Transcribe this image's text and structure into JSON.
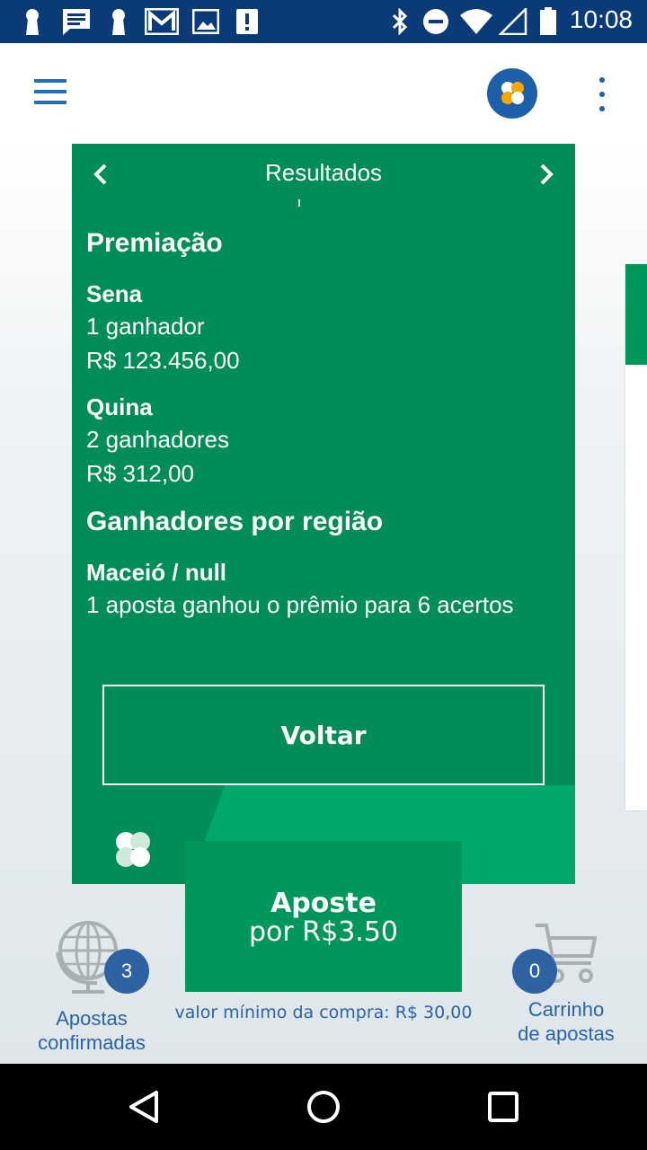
{
  "status_bar": {
    "time": "10:08",
    "icons": [
      "keyhole-icon",
      "message-icon",
      "keyhole-icon",
      "gmail-icon",
      "image-icon",
      "alert-icon",
      "bluetooth-icon",
      "do-not-disturb-icon",
      "wifi-icon",
      "signal-icon",
      "battery-icon"
    ]
  },
  "header": {
    "menu_icon": "hamburger-menu-icon",
    "logo_icon": "clover-logo-icon",
    "overflow_icon": "more-vertical-icon"
  },
  "card": {
    "title": "Resultados",
    "prev_icon": "chevron-left-icon",
    "next_icon": "chevron-right-icon",
    "premiacao_heading": "Premiação",
    "prizes": [
      {
        "name": "Sena",
        "winners": "1 ganhador",
        "amount": "R$ 123.456,00"
      },
      {
        "name": "Quina",
        "winners": "2 ganhadores",
        "amount": "R$ 312,00"
      }
    ],
    "regiao_heading": "Ganhadores por região",
    "regions": [
      {
        "place": "Maceió / null",
        "detail": "1 aposta ganhou o prêmio para 6 acertos"
      }
    ],
    "back_label": "Voltar"
  },
  "bet": {
    "line1": "Aposte",
    "line2": "por R$3.50",
    "min_value": "valor mínimo da compra: R$ 30,00"
  },
  "confirmed": {
    "count": "3",
    "label_line1": "Apostas",
    "label_line2": "confirmadas"
  },
  "cart": {
    "count": "0",
    "label_line1": "Carrinho",
    "label_line2": "de apostas"
  },
  "colors": {
    "status_bar": "#0a3a78",
    "card_green": "#008d57",
    "bright_green": "#00a86b",
    "accent_blue": "#1d5fa8",
    "clover_yellow": "#f6a800"
  }
}
